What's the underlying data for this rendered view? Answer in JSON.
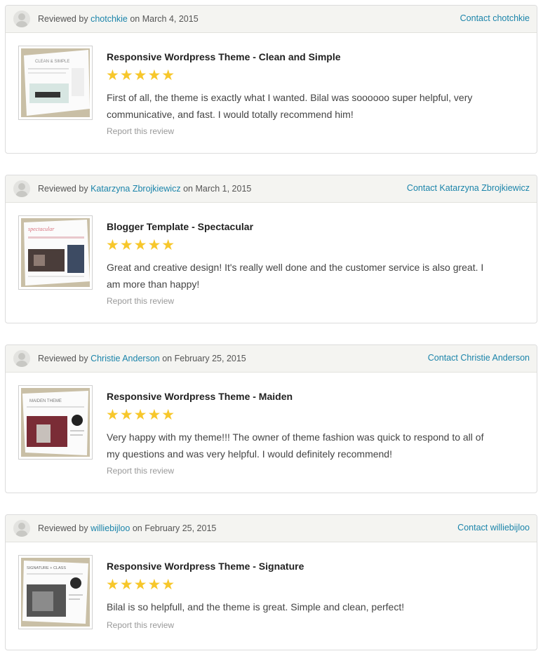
{
  "common": {
    "reviewed_by_prefix": "Reviewed by",
    "on_word": "on",
    "report_label": "Report this review",
    "star_glyphs": "★★★★★"
  },
  "reviews": [
    {
      "reviewer": "chotchkie",
      "date": "March 4, 2015",
      "contact_label": "Contact chotchkie",
      "item_title": "Responsive Wordpress Theme - Clean and Simple",
      "rating": 5,
      "text": "First of all, the theme is exactly what I wanted. Bilal was soooooo super helpful, very communicative, and fast. I would totally recommend him!",
      "thumb_label": "CLEAN & SIMPLE"
    },
    {
      "reviewer": "Katarzyna Zbrojkiewicz",
      "date": "March 1, 2015",
      "contact_label": "Contact Katarzyna Zbrojkiewicz",
      "item_title": "Blogger Template - Spectacular",
      "rating": 5,
      "text": "Great and creative design! It's really well done and the customer service is also great. I am more than happy!",
      "thumb_label": "spectacular"
    },
    {
      "reviewer": "Christie Anderson",
      "date": "February 25, 2015",
      "contact_label": "Contact Christie Anderson",
      "item_title": "Responsive Wordpress Theme - Maiden",
      "rating": 5,
      "text": "Very happy with my theme!!! The owner of theme fashion was quick to respond to all of my questions and was very helpful. I would definitely recommend!",
      "thumb_label": "MAIDEN THEME"
    },
    {
      "reviewer": "williebijloo",
      "date": "February 25, 2015",
      "contact_label": "Contact williebijloo",
      "item_title": "Responsive Wordpress Theme - Signature",
      "rating": 5,
      "text": "Bilal is so helpfull, and the theme is great. Simple and clean, perfect!",
      "thumb_label": "SIGNATURE + CLASS"
    }
  ],
  "colors": {
    "link": "#1b84aa",
    "star": "#f7c72b",
    "header_bg": "#f4f4f1",
    "thumb_frame": "#c9bfa6"
  }
}
